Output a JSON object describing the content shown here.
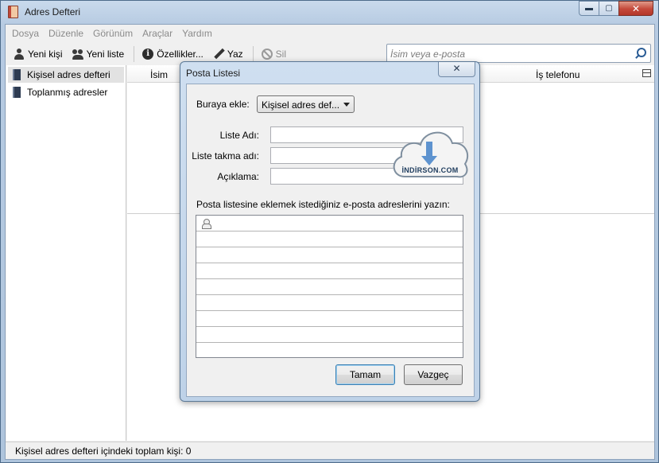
{
  "window": {
    "title": "Adres Defteri",
    "caption": {
      "minimize": "▬",
      "maximize": "▢",
      "close": "✕"
    }
  },
  "menubar": {
    "items": [
      "Dosya",
      "Düzenle",
      "Görünüm",
      "Araçlar",
      "Yardım"
    ]
  },
  "toolbar": {
    "new_contact": "Yeni kişi",
    "new_list": "Yeni liste",
    "properties": "Özellikler...",
    "write": "Yaz",
    "delete": "Sil"
  },
  "search": {
    "placeholder": "İsim veya e-posta"
  },
  "sidebar": {
    "items": [
      {
        "label": "Kişisel adres defteri",
        "selected": true
      },
      {
        "label": "Toplanmış adresler",
        "selected": false
      }
    ]
  },
  "columns": {
    "name": "İsim",
    "work_phone": "İş telefonu"
  },
  "status": {
    "text": "Kişisel adres defteri içindeki toplam kişi: 0"
  },
  "dialog": {
    "title": "Posta Listesi",
    "close": "✕",
    "add_to_label": "Buraya ekle:",
    "add_to_value": "Kişisel adres def...",
    "list_name_label": "Liste Adı:",
    "nickname_label": "Liste takma adı:",
    "description_label": "Açıklama:",
    "hint": "Posta listesine eklemek istediğiniz e-posta adreslerini yazın:",
    "ok": "Tamam",
    "cancel": "Vazgeç"
  },
  "watermark": {
    "text": "İNDİRSON.COM",
    "icon": "cloud-download-icon"
  },
  "colors": {
    "titlebar": "#c9daec",
    "close_button": "#c4493a",
    "default_button_border": "#3c7fb1"
  }
}
